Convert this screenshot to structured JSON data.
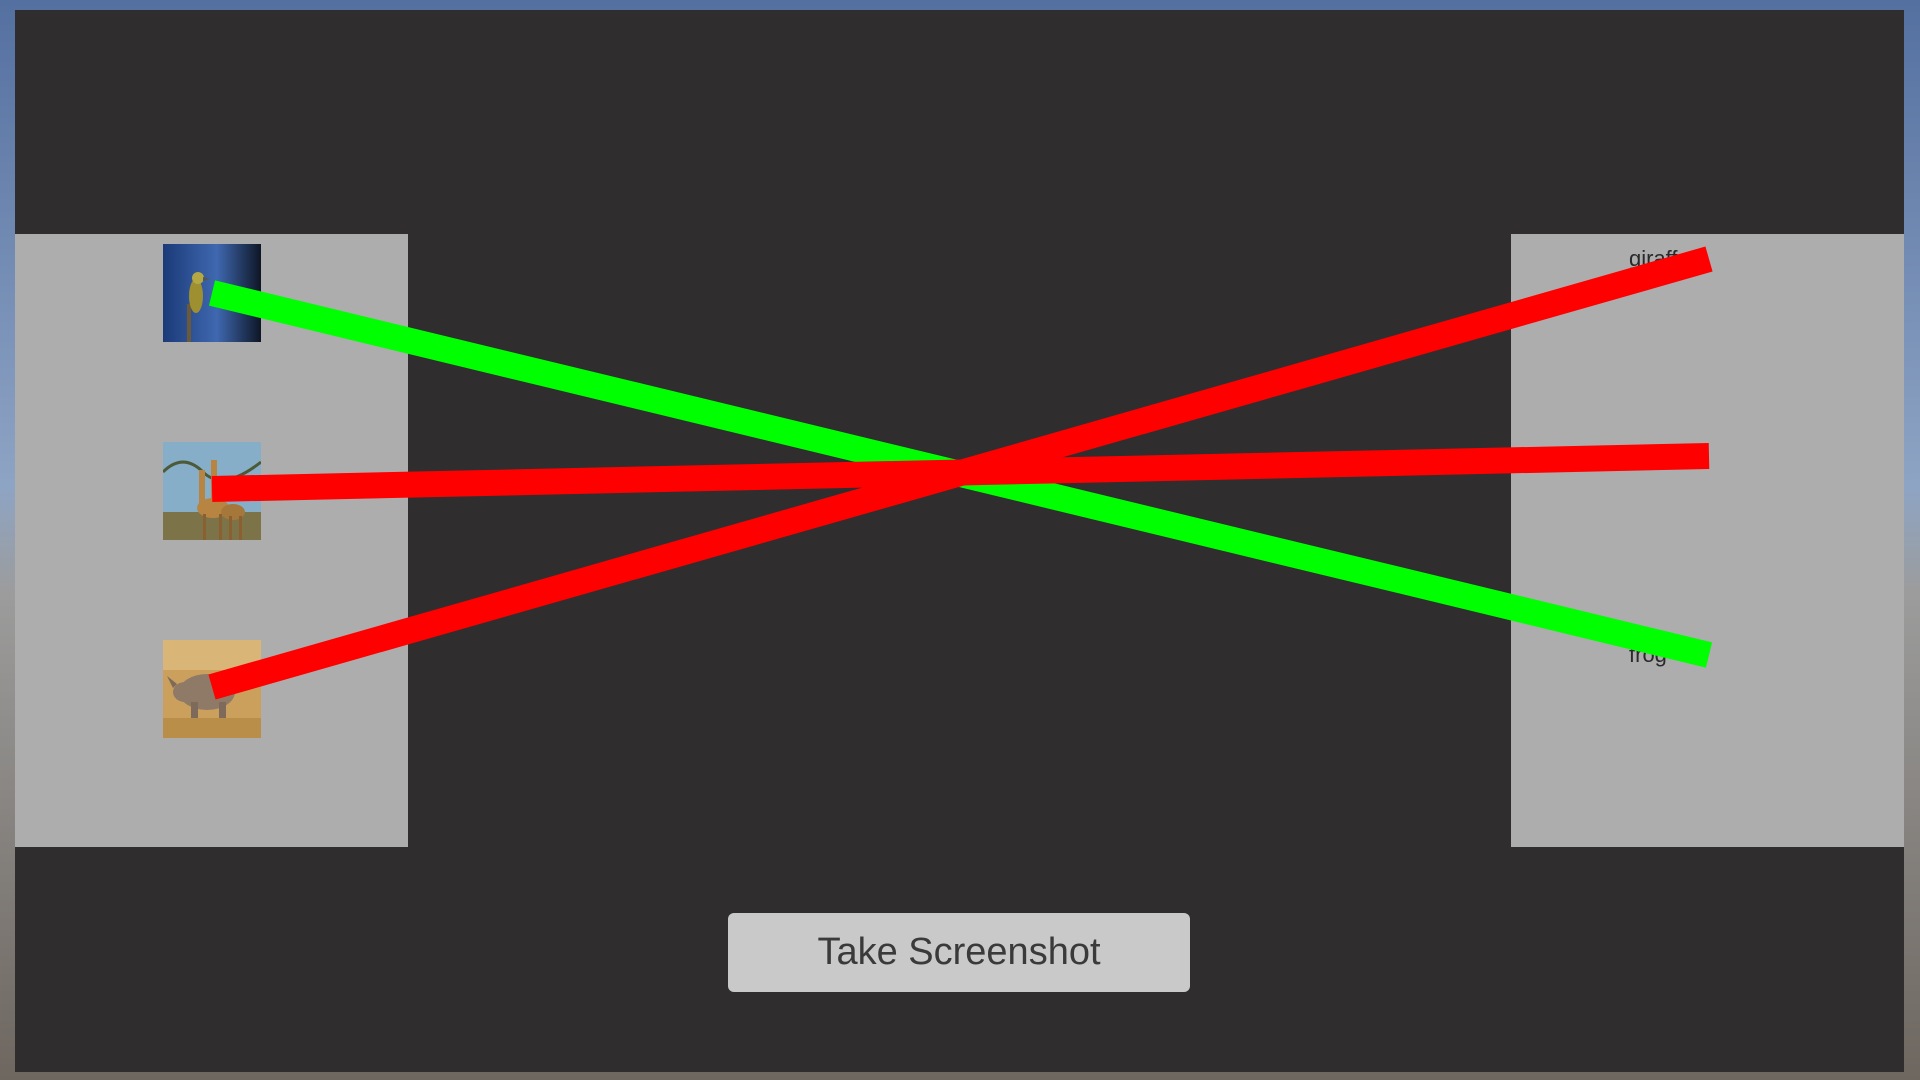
{
  "right_panel": {
    "labels": [
      "giraffe",
      "frog"
    ]
  },
  "left_panel": {
    "images": [
      "bird-image",
      "giraffe-image",
      "rhino-image"
    ]
  },
  "button": {
    "label": "Take Screenshot"
  },
  "colors": {
    "background": "#2f2d2e",
    "panel": "#adadad",
    "line_correct": "#00ff00",
    "line_wrong": "#ff0000",
    "button": "#c9c9c9"
  }
}
